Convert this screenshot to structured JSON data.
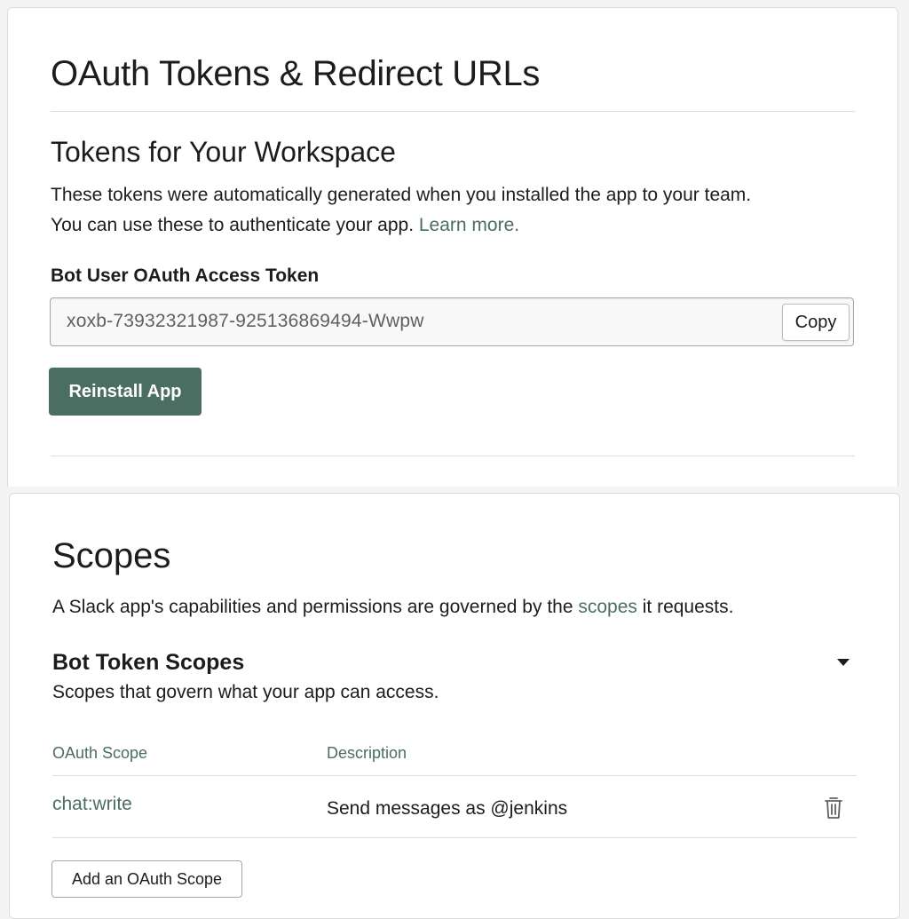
{
  "oauth": {
    "title": "OAuth Tokens & Redirect URLs",
    "workspace_heading": "Tokens for Your Workspace",
    "desc_line1": "These tokens were automatically generated when you installed the app to your team.",
    "desc_line2": "You can use these to authenticate your app.",
    "learn_more": "Learn more.",
    "token_label": "Bot User OAuth Access Token",
    "token_value": "xoxb-73932321987-925136869494-Wwpw",
    "copy_label": "Copy",
    "reinstall_label": "Reinstall App"
  },
  "scopes": {
    "title": "Scopes",
    "desc_prefix": "A Slack app's capabilities and permissions are governed by the",
    "desc_link": "scopes",
    "desc_suffix": "it requests.",
    "bot_heading": "Bot Token Scopes",
    "bot_sub": "Scopes that govern what your app can access.",
    "columns": [
      "OAuth Scope",
      "Description"
    ],
    "rows": [
      {
        "scope": "chat:write",
        "description": "Send messages as @jenkins",
        "action_icon": "trash-icon"
      }
    ],
    "add_label": "Add an OAuth Scope"
  },
  "colors": {
    "accent": "#4a6e62",
    "text": "#1d1c1d",
    "border": "#dddddd"
  }
}
